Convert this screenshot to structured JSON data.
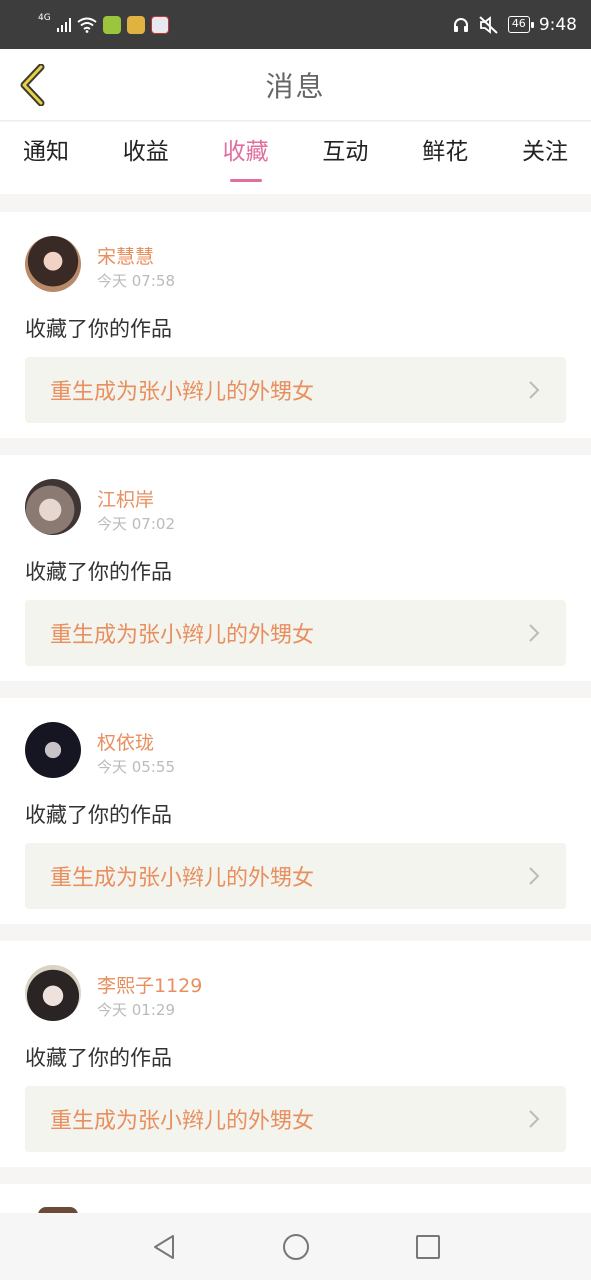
{
  "status_bar": {
    "network": "4G",
    "battery": "46",
    "time": "9:48"
  },
  "header": {
    "title": "消息",
    "back_icon": "chevron-left-icon"
  },
  "tabs": [
    {
      "label": "通知",
      "active": false
    },
    {
      "label": "收益",
      "active": false
    },
    {
      "label": "收藏",
      "active": true
    },
    {
      "label": "互动",
      "active": false
    },
    {
      "label": "鲜花",
      "active": false
    },
    {
      "label": "关注",
      "active": false
    }
  ],
  "messages": [
    {
      "user": "宋慧慧",
      "time": "今天 07:58",
      "action": "收藏了你的作品",
      "work": "重生成为张小辫儿的外甥女"
    },
    {
      "user": "江枳岸",
      "time": "今天 07:02",
      "action": "收藏了你的作品",
      "work": "重生成为张小辫儿的外甥女"
    },
    {
      "user": "权依珑",
      "time": "今天 05:55",
      "action": "收藏了你的作品",
      "work": "重生成为张小辫儿的外甥女"
    },
    {
      "user": "李熙子1129",
      "time": "今天 01:29",
      "action": "收藏了你的作品",
      "work": "重生成为张小辫儿的外甥女"
    }
  ],
  "colors": {
    "accent_pink": "#e06fa0",
    "name_orange": "#e88f5f",
    "link_bg": "#f4f4ee",
    "status_bar_bg": "#3d3d3d"
  },
  "nav_bar": {
    "back_icon": "triangle-back-icon",
    "home_icon": "circle-home-icon",
    "recents_icon": "square-recents-icon"
  }
}
